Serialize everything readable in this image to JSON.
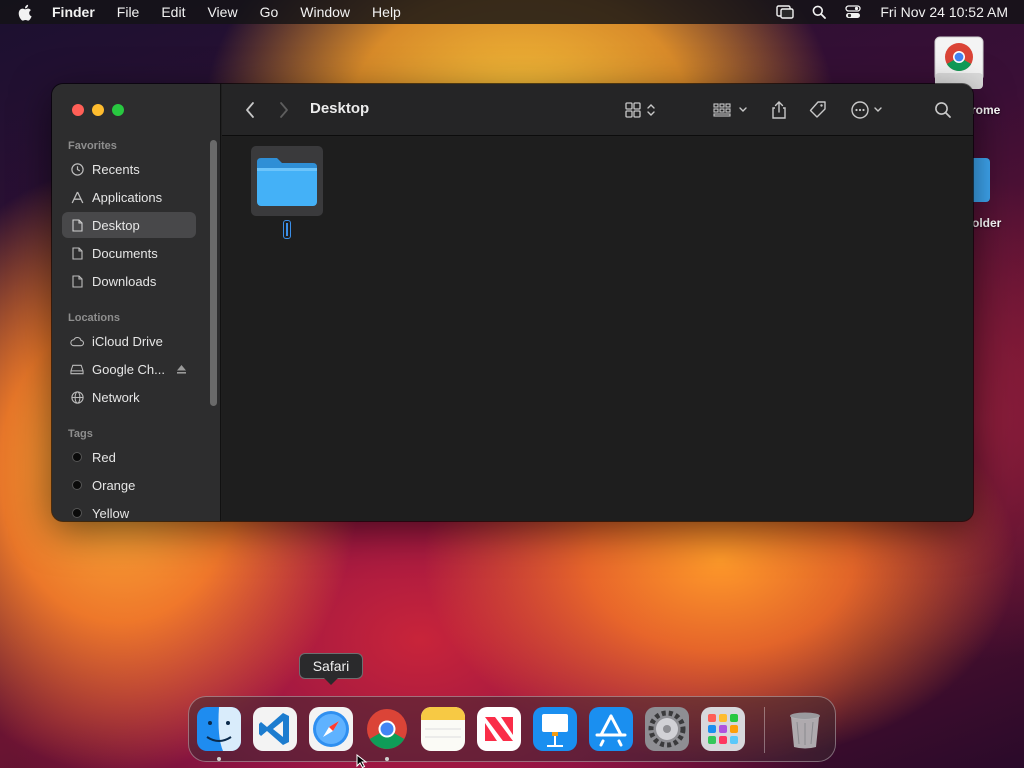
{
  "menubar": {
    "app_name": "Finder",
    "items": [
      "File",
      "Edit",
      "View",
      "Go",
      "Window",
      "Help"
    ],
    "clock": "Fri Nov 24  10:52 AM"
  },
  "desktop": {
    "icons": [
      {
        "label": "rome"
      },
      {
        "label": "older"
      }
    ]
  },
  "finder": {
    "title": "Desktop",
    "sections": {
      "favorites": "Favorites",
      "locations": "Locations",
      "tags": "Tags"
    },
    "favorites": [
      {
        "label": "Recents",
        "icon": "clock-icon"
      },
      {
        "label": "Applications",
        "icon": "applications-icon"
      },
      {
        "label": "Desktop",
        "icon": "document-icon",
        "active": true
      },
      {
        "label": "Documents",
        "icon": "document-icon"
      },
      {
        "label": "Downloads",
        "icon": "document-icon"
      }
    ],
    "locations": [
      {
        "label": "iCloud Drive",
        "icon": "cloud-icon"
      },
      {
        "label": "Google Ch...",
        "icon": "drive-icon"
      },
      {
        "label": "Network",
        "icon": "globe-icon"
      }
    ],
    "tags": [
      {
        "label": "Red"
      },
      {
        "label": "Orange"
      },
      {
        "label": "Yellow"
      }
    ]
  },
  "tooltip": {
    "label": "Safari"
  },
  "dock": {
    "apps": [
      "Finder",
      "Visual Studio Code",
      "Safari",
      "Google Chrome",
      "Notes",
      "News",
      "Keynote",
      "App Store",
      "System Settings",
      "Launchpad",
      "Trash"
    ]
  },
  "colors": {
    "accent": "#3b8fe8",
    "folder": "#3fa9f5",
    "traffic_red": "#ff5f57",
    "traffic_yellow": "#febc2e",
    "traffic_green": "#28c840"
  }
}
